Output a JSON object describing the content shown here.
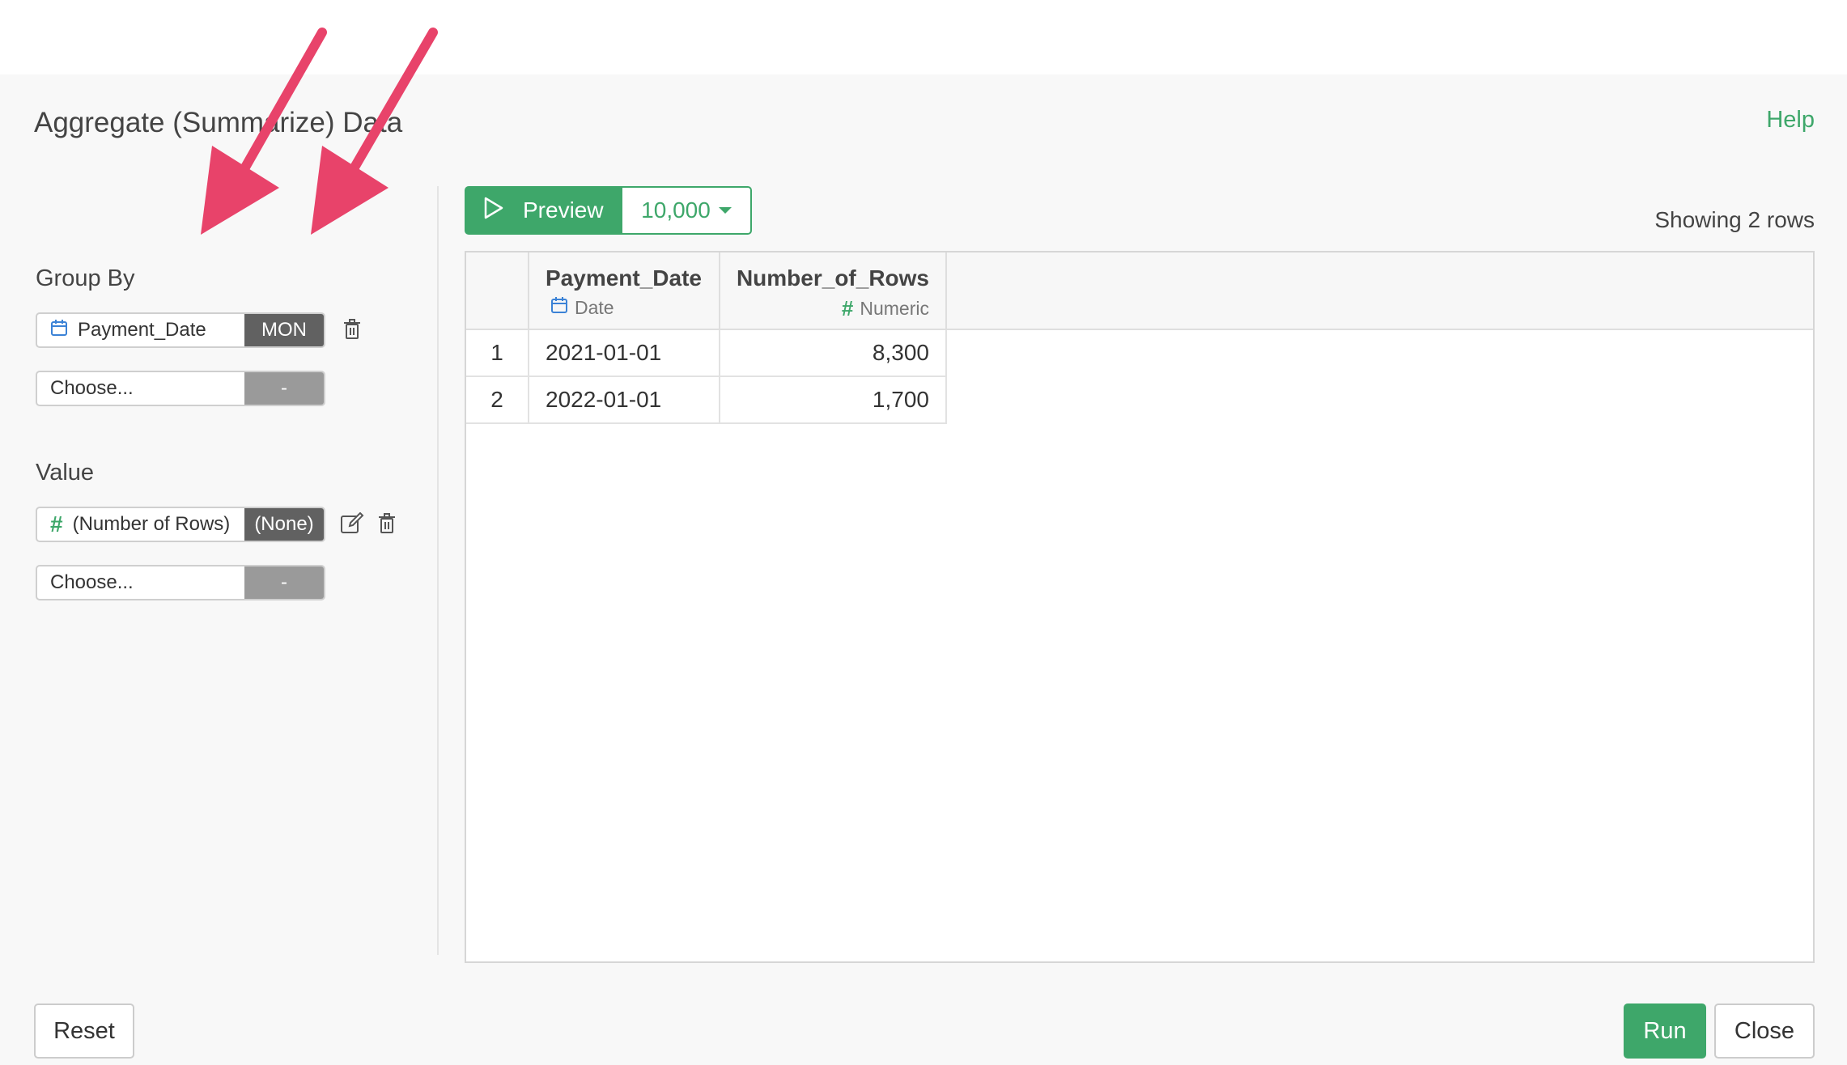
{
  "dialog": {
    "title": "Aggregate (Summarize) Data",
    "help_label": "Help"
  },
  "group_by": {
    "label": "Group By",
    "rows": [
      {
        "field": "Payment_Date",
        "field_icon": "calendar-icon",
        "op": "MON"
      },
      {
        "field": "Choose...",
        "op": "-"
      }
    ]
  },
  "value": {
    "label": "Value",
    "rows": [
      {
        "field": "(Number of Rows)",
        "field_icon": "hash-icon",
        "op": "(None)"
      },
      {
        "field": "Choose...",
        "op": "-"
      }
    ]
  },
  "preview": {
    "button_label": "Preview",
    "row_limit": "10,000",
    "showing": "Showing 2 rows"
  },
  "table": {
    "columns": [
      {
        "name": "Payment_Date",
        "type": "Date",
        "type_icon": "calendar-icon"
      },
      {
        "name": "Number_of_Rows",
        "type": "Numeric",
        "type_icon": "hash-icon"
      }
    ],
    "rows": [
      {
        "index": "1",
        "payment_date": "2021-01-01",
        "number_of_rows": "8,300"
      },
      {
        "index": "2",
        "payment_date": "2022-01-01",
        "number_of_rows": "1,700"
      }
    ]
  },
  "footer": {
    "reset_label": "Reset",
    "run_label": "Run",
    "close_label": "Close"
  },
  "colors": {
    "accent": "#3ea76a",
    "annotation_arrow": "#e8436a",
    "date_icon": "#3b82d6"
  }
}
